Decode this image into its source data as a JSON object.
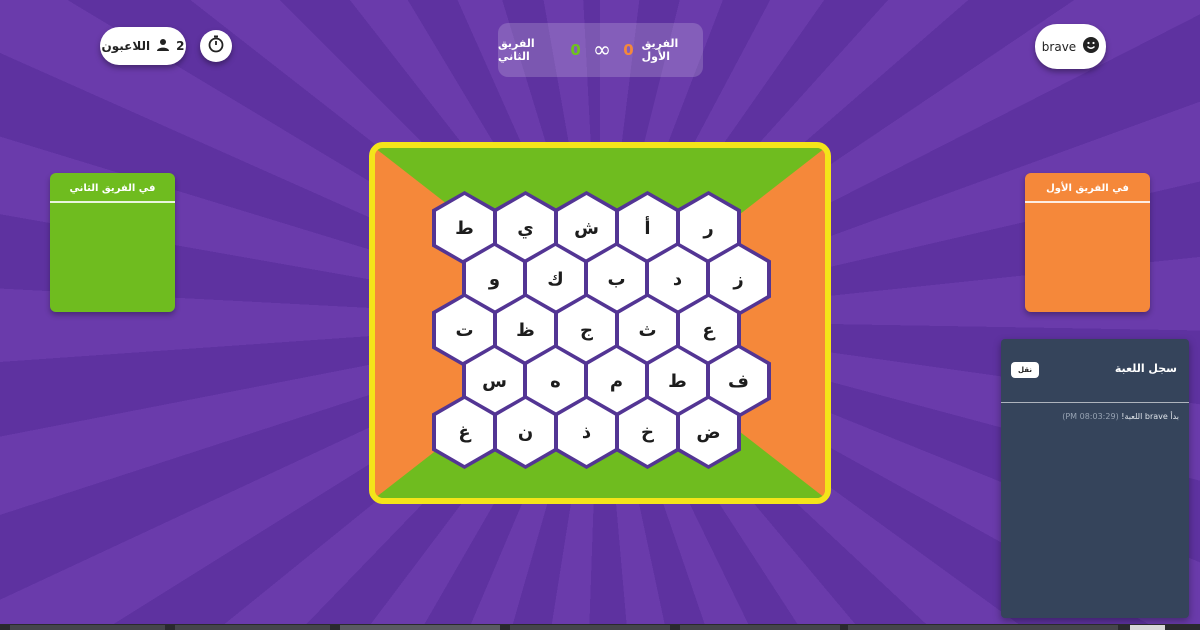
{
  "header": {
    "players_label": "اللاعبون",
    "players_count": "2",
    "username": "brave"
  },
  "scoreboard": {
    "team_a_label": "الفريق الأول",
    "team_a_score": "0",
    "infinity": "∞",
    "team_b_score": "0",
    "team_b_label": "الفريق الثاني"
  },
  "team_panels": {
    "team_b_title": "في الفريق الثاني",
    "team_a_title": "في الفريق الأول"
  },
  "board": {
    "rows": [
      [
        "ر",
        "أ",
        "ش",
        "ي",
        "ط"
      ],
      [
        "ز",
        "د",
        "ب",
        "ك",
        "و"
      ],
      [
        "ع",
        "ث",
        "ج",
        "ظ",
        "ت"
      ],
      [
        "ف",
        "ط",
        "م",
        "ه",
        "س"
      ],
      [
        "ض",
        "خ",
        "ذ",
        "ن",
        "غ"
      ]
    ]
  },
  "log": {
    "title": "سجل اللعبة",
    "copy_label": "نقل",
    "entry_time": "(PM 08:03:29)",
    "entry_text": "بدأ brave اللعبة!"
  },
  "colors": {
    "team_a": "#f5883a",
    "team_b": "#6fbc1f",
    "board_border": "#f4e41a",
    "hex_border": "#533594",
    "log_bg": "#35445b"
  }
}
